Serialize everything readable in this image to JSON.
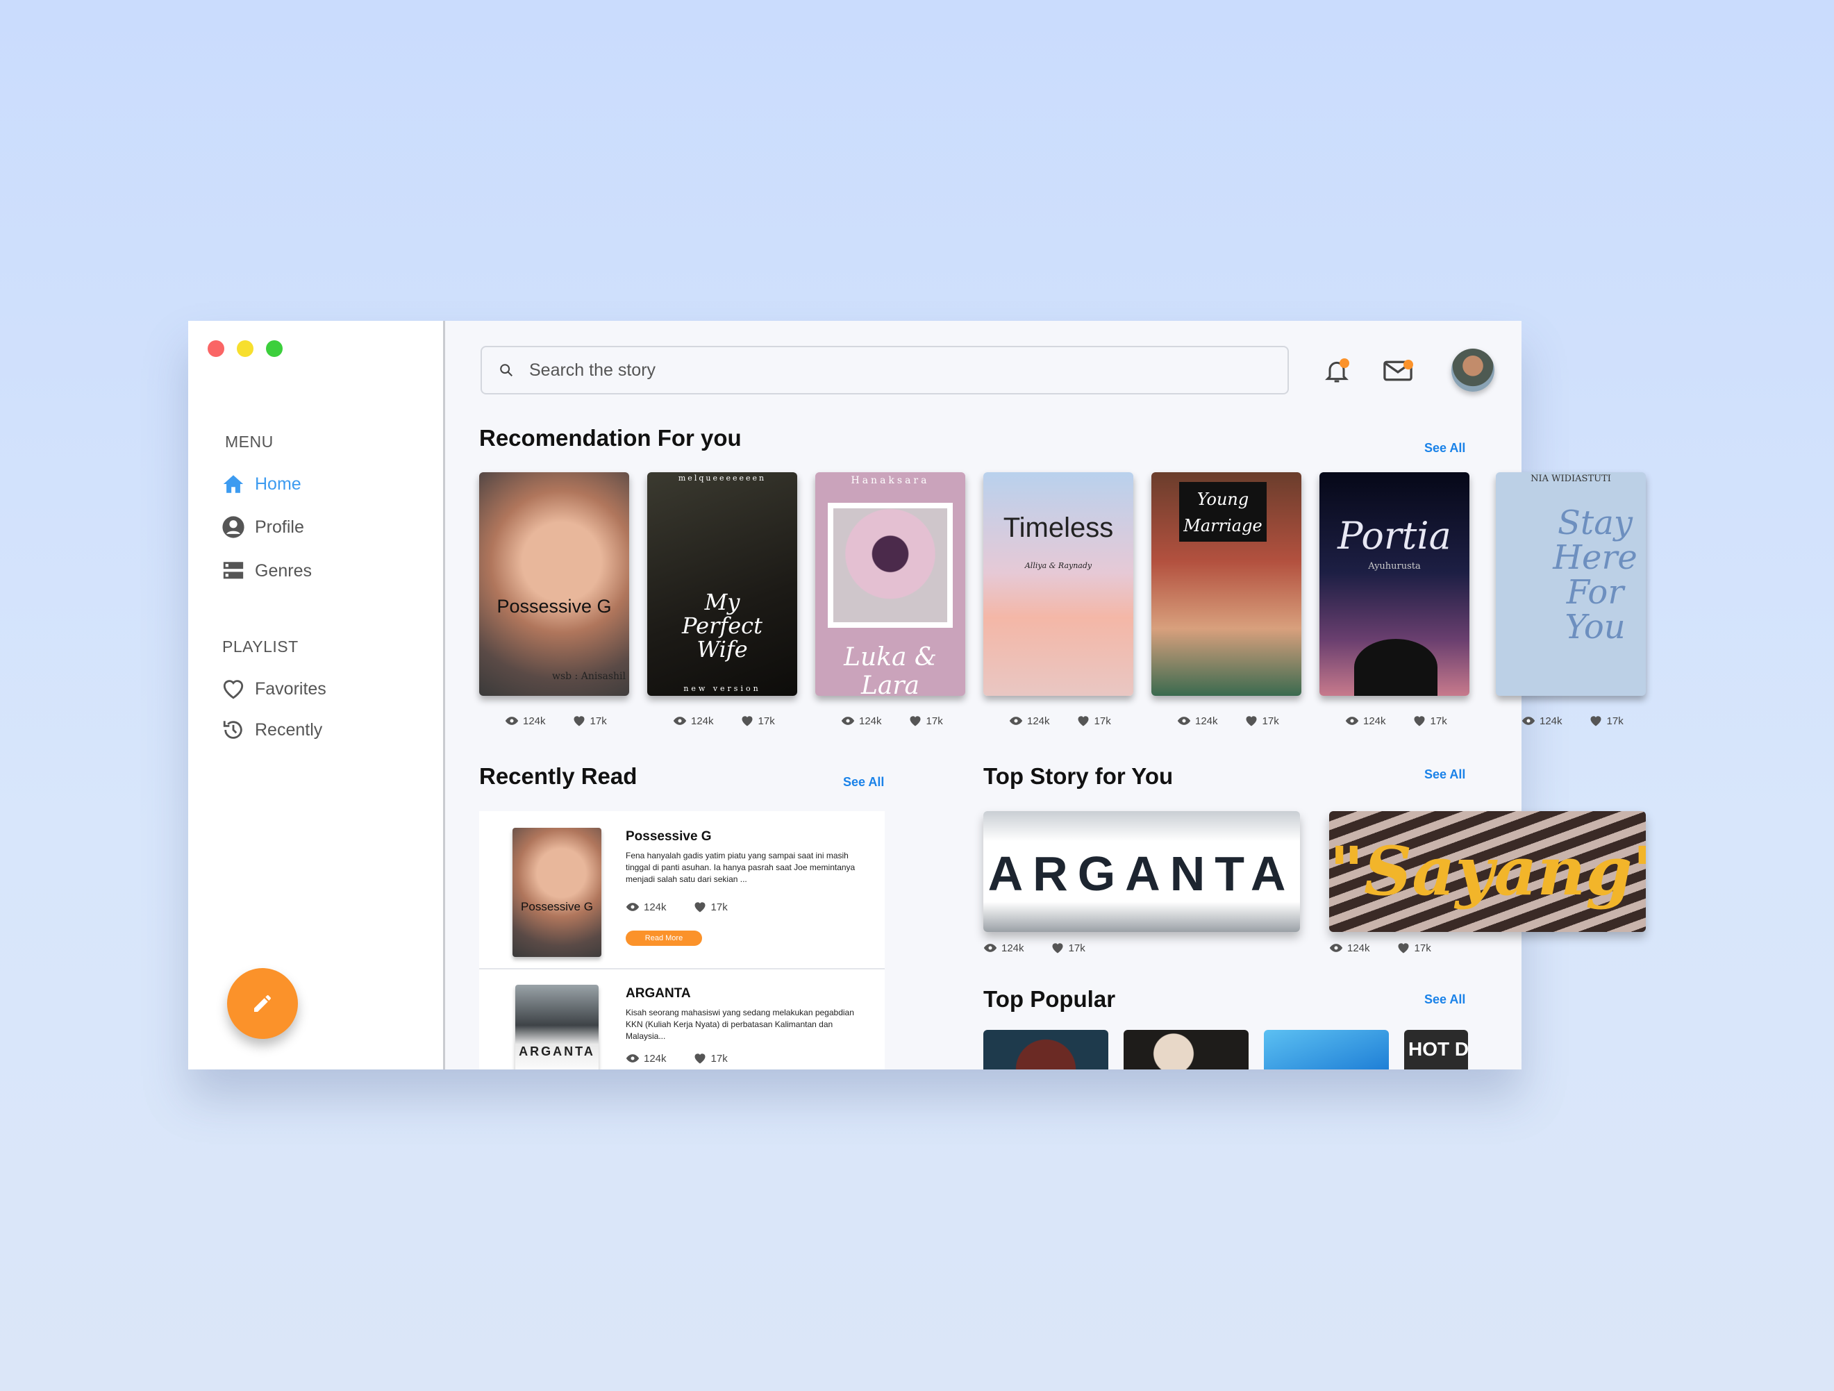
{
  "window": {
    "controls": [
      "close",
      "minimize",
      "maximize"
    ],
    "control_colors": [
      "#fa6565",
      "#f7df2e",
      "#3ccf3c"
    ]
  },
  "sidebar": {
    "menu_heading": "MENU",
    "menu_items": [
      {
        "label": "Home",
        "icon": "home-icon",
        "active": true
      },
      {
        "label": "Profile",
        "icon": "user-circle-icon"
      },
      {
        "label": "Genres",
        "icon": "list-icon"
      }
    ],
    "playlist_heading": "PLAYLIST",
    "playlist_items": [
      {
        "label": "Favorites",
        "icon": "heart-icon"
      },
      {
        "label": "Recently",
        "icon": "history-icon"
      }
    ],
    "fab_icon": "pencil-icon"
  },
  "search": {
    "placeholder": "Search the story"
  },
  "header": {
    "icons": [
      "bell-icon",
      "mail-icon"
    ],
    "badge_color": "#fb922a"
  },
  "recommendation": {
    "title": "Recomendation For you",
    "see_all": "See All",
    "books": [
      {
        "title": "Possessive G",
        "author": "wsb : Anisashil",
        "views": "124k",
        "likes": "17k"
      },
      {
        "title": "My Perfect Wife",
        "top": "melqueeeeeeen",
        "bottom": "new version",
        "views": "124k",
        "likes": "17k"
      },
      {
        "title": "Luka & Lara",
        "top": "Hanaksara",
        "views": "124k",
        "likes": "17k"
      },
      {
        "title": "Timeless",
        "author": "Alliya & Raynady",
        "views": "124k",
        "likes": "17k"
      },
      {
        "title": "Young Marriage",
        "views": "124k",
        "likes": "17k"
      },
      {
        "title": "Portia",
        "author": "Ayuhurusta",
        "views": "124k",
        "likes": "17k"
      },
      {
        "title": "Stay Here For You",
        "top": "NIA WIDIASTUTI",
        "views": "124k",
        "likes": "17k"
      }
    ]
  },
  "recently_read": {
    "title": "Recently Read",
    "see_all": "See All",
    "items": [
      {
        "title": "Possessive G",
        "description": "Fena hanyalah gadis yatim piatu yang sampai saat ini masih tinggal di panti asuhan. Ia hanya pasrah saat Joe memintanya menjadi salah satu dari sekian ...",
        "views": "124k",
        "likes": "17k",
        "button": "Read More",
        "cover_text": "Possessive G"
      },
      {
        "title": "ARGANTA",
        "description": "Kisah seorang mahasiswi yang sedang melakukan pegabdian KKN (Kuliah Kerja Nyata) di perbatasan Kalimantan dan Malaysia...",
        "views": "124k",
        "likes": "17k",
        "cover_text": "ARGANTA"
      }
    ]
  },
  "top_story": {
    "title": "Top Story for You",
    "see_all": "See All",
    "items": [
      {
        "title": "ARGANTA",
        "views": "124k",
        "likes": "17k"
      },
      {
        "title": "\"Sayang\"",
        "views": "124k",
        "likes": "17k"
      }
    ]
  },
  "top_popular": {
    "title": "Top Popular",
    "see_all": "See All",
    "items": [
      {
        "label": ""
      },
      {
        "label": ""
      },
      {
        "label": ""
      },
      {
        "label": "HOT D"
      }
    ]
  }
}
